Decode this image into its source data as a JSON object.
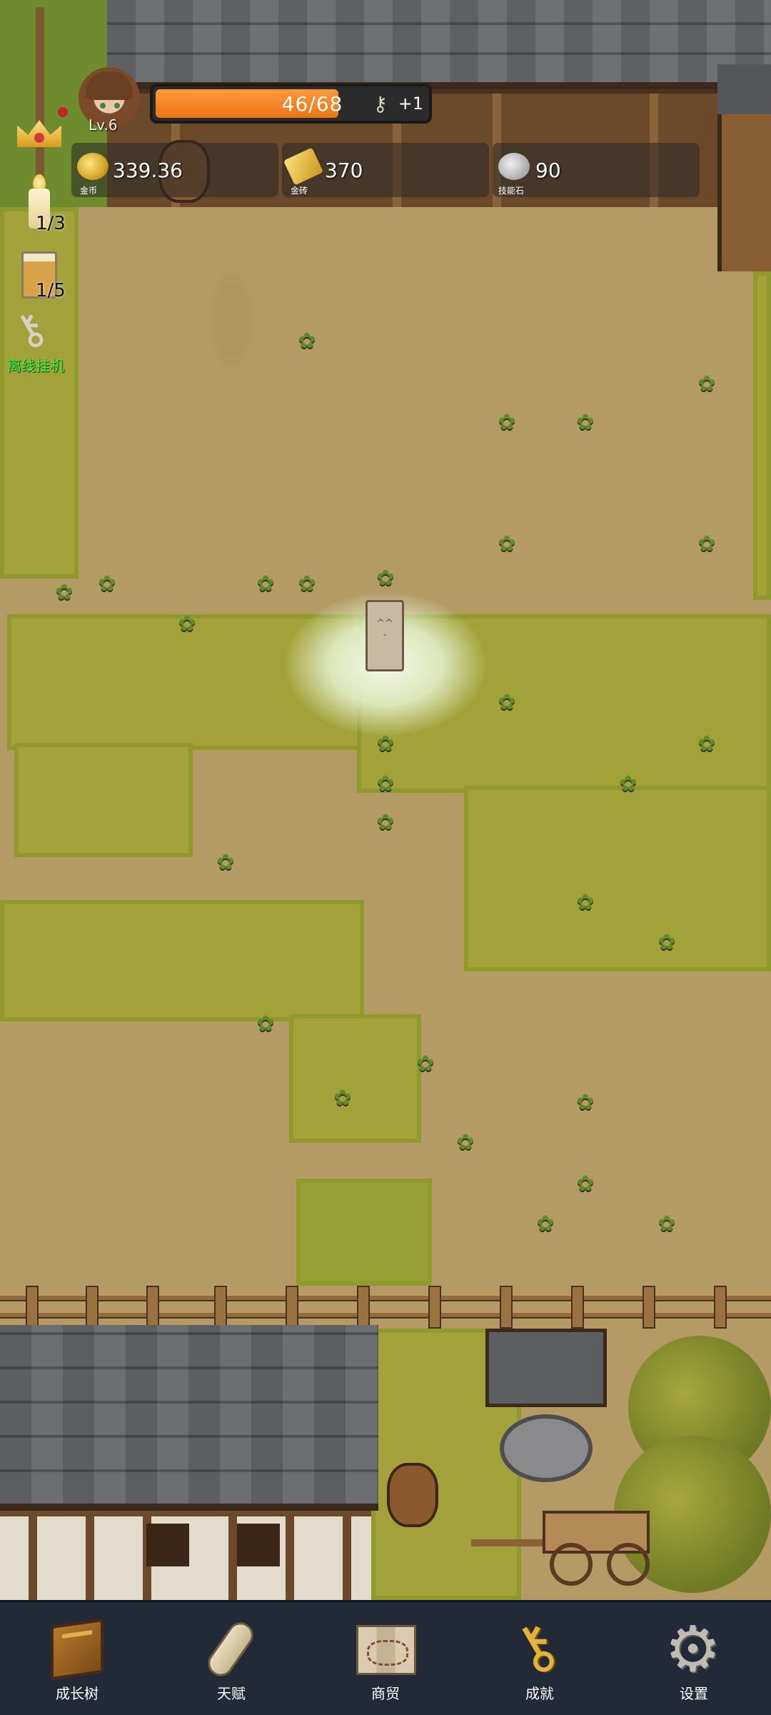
{
  "player": {
    "level_label": "Lv.6",
    "xp_text": "46/68",
    "xp_current": 46,
    "xp_max": 68,
    "xp_bonus": "+1"
  },
  "resources": [
    {
      "name": "gold-coin",
      "value": "339.36",
      "label": "金币",
      "icon": "coin-icon"
    },
    {
      "name": "gold-brick",
      "value": "370",
      "label": "金砖",
      "icon": "gold-brick-icon"
    },
    {
      "name": "skill-stone",
      "value": "90",
      "label": "技能石",
      "icon": "stone-icon"
    }
  ],
  "side": {
    "candle_count": "1/3",
    "cup_count": "1/5",
    "auto_label": "离线挂机"
  },
  "nav": [
    {
      "id": "growth-tree",
      "label": "成长树",
      "icon": "book-icon"
    },
    {
      "id": "talent",
      "label": "天赋",
      "icon": "scroll-icon"
    },
    {
      "id": "trade",
      "label": "商贸",
      "icon": "map-icon"
    },
    {
      "id": "achievement",
      "label": "成就",
      "icon": "golden-key-icon"
    },
    {
      "id": "settings",
      "label": "设置",
      "icon": "gear-icon"
    }
  ],
  "colors": {
    "xp_fill": "#ea7415",
    "nav_background": "#222a37",
    "auto_label": "#3df23d"
  }
}
